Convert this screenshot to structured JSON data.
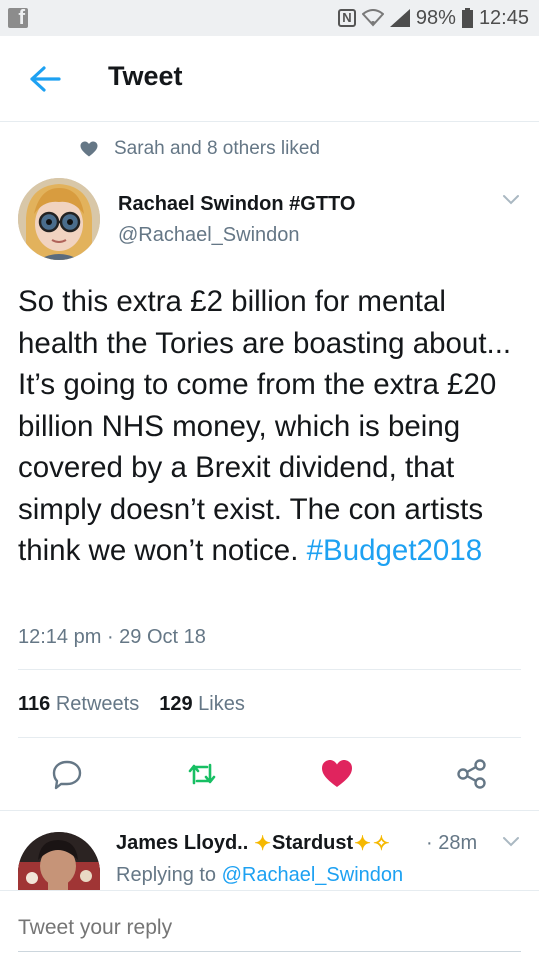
{
  "status_bar": {
    "app_icon": "f",
    "nfc": "N",
    "battery": "98%",
    "time": "12:45"
  },
  "header": {
    "title": "Tweet"
  },
  "social_context": {
    "text": "Sarah and 8 others liked"
  },
  "tweet": {
    "author_name": "Rachael Swindon #GTTO",
    "author_handle": "@Rachael_Swindon",
    "text": "So this extra £2 billion for mental health the Tories are boasting about... It’s going to come from the extra £20 billion NHS money, which is being covered by a Brexit dividend, that simply doesn’t exist. The con artists think we won’t notice.",
    "hashtag": "#Budget2018",
    "timestamp": "12:14 pm · 29 Oct 18",
    "retweets_count": "116",
    "retweets_label": "Retweets",
    "likes_count": "129",
    "likes_label": "Likes"
  },
  "actions": {
    "reply_icon": "reply-icon",
    "retweet_icon": "retweet-icon",
    "like_icon": "heart-icon",
    "share_icon": "share-icon"
  },
  "reply": {
    "author_name_part1": "James Lloyd..",
    "author_name_part2": "Stardust",
    "time": "· 28m",
    "replying_prefix": "Replying to",
    "replying_handle": "@Rachael_Swindon"
  },
  "composer": {
    "placeholder": "Tweet your reply"
  },
  "colors": {
    "accent": "#1da1f2",
    "retweet_green": "#17bf63",
    "like_red": "#e0245e",
    "muted": "#657786"
  }
}
